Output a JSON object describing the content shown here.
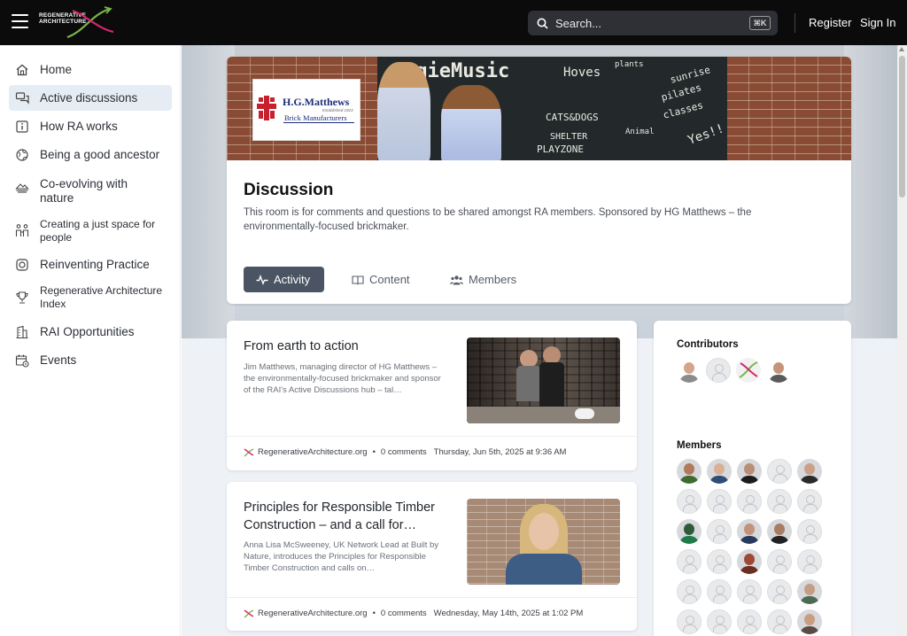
{
  "topbar": {
    "logo_line1": "REGENERATIVE",
    "logo_line2": "ARCHITECTURE",
    "search_placeholder": "Search...",
    "search_shortcut": "⌘K",
    "register_label": "Register",
    "signin_label": "Sign In"
  },
  "sidebar": {
    "items": [
      {
        "label": "Home",
        "icon": "home-icon",
        "active": false
      },
      {
        "label": "Active discussions",
        "icon": "chat-icon",
        "active": true
      },
      {
        "label": "How RA works",
        "icon": "info-icon",
        "active": false
      },
      {
        "label": "Being a good ancestor",
        "icon": "globe-icon",
        "active": false
      },
      {
        "label": "Co-evolving with nature",
        "icon": "landscape-icon",
        "active": false
      },
      {
        "label": "Creating a just space for people",
        "icon": "people-icon",
        "active": false
      },
      {
        "label": "Reinventing Practice",
        "icon": "target-icon",
        "active": false
      },
      {
        "label": "Regenerative Architecture Index",
        "icon": "trophy-icon",
        "active": false
      },
      {
        "label": "RAI Opportunities",
        "icon": "building-icon",
        "active": false
      },
      {
        "label": "Events",
        "icon": "calendar-icon",
        "active": false
      }
    ]
  },
  "banner": {
    "logo_name": "H.G.Matthews",
    "logo_established": "Established 1923",
    "logo_sub": "Brick Manufacturers"
  },
  "room": {
    "title": "Discussion",
    "description": "This room is for comments and questions to be shared amongst RA members. Sponsored by HG Matthews – the environmentally-focused brickmaker.",
    "tabs": [
      "Activity",
      "Content",
      "Members"
    ],
    "active_tab": "Activity"
  },
  "articles": [
    {
      "title": "From earth to action",
      "excerpt": "Jim Matthews, managing director of HG Matthews – the environmentally-focused brickmaker and sponsor of the RAI's Active Discussions hub – tal…",
      "source": "RegenerativeArchitecture.org",
      "comments": "0 comments",
      "date": "Thursday, Jun 5th, 2025 at 9:36 AM"
    },
    {
      "title": "Principles for Responsible Timber Construction – and a call for…",
      "excerpt": "Anna Lisa McSweeney, UK Network Lead at Built by Nature, introduces the Principles for Responsible Timber Construction and calls on…",
      "source": "RegenerativeArchitecture.org",
      "comments": "0 comments",
      "date": "Wednesday, May 14th, 2025 at 1:02 PM"
    }
  ],
  "people": {
    "contributors_heading": "Contributors",
    "members_heading": "Members"
  },
  "colors": {
    "topbar": "#0b0b0b",
    "active_tab": "#4a5463",
    "sidebar_active": "#e6ecf3",
    "hg_blue": "#1d2c79",
    "hg_red": "#c8202d"
  }
}
